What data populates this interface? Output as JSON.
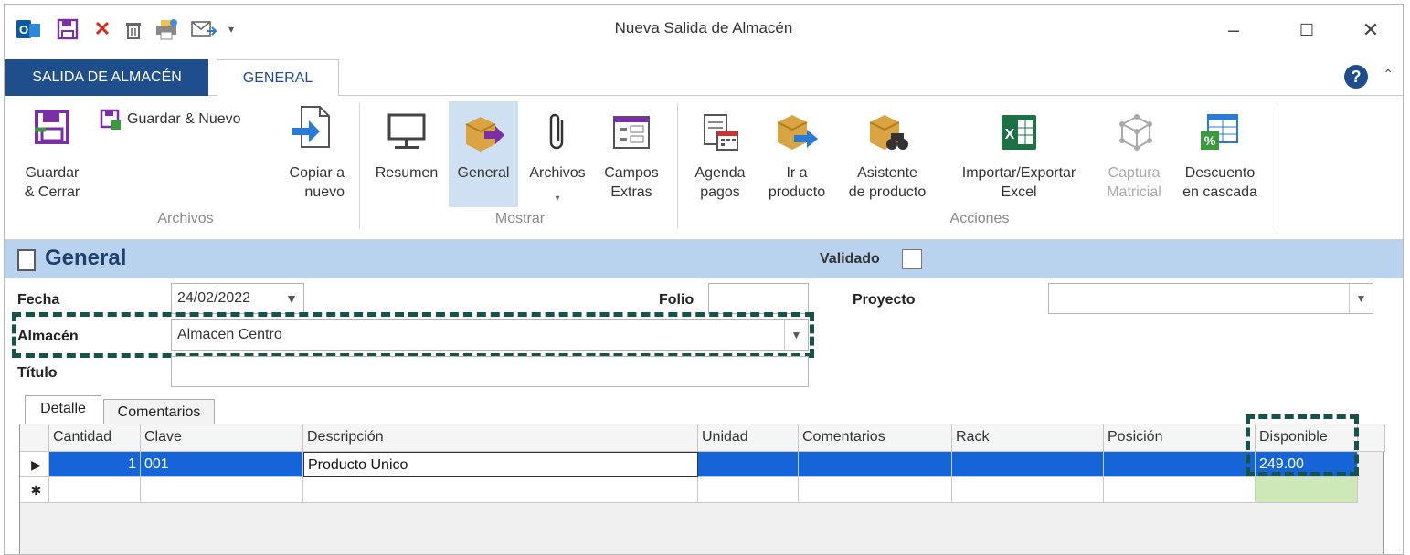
{
  "window": {
    "title": "Nueva Salida de Almacén"
  },
  "tabs": {
    "file_label": "SALIDA DE ALMACÉN",
    "general_label": "GENERAL"
  },
  "ribbon": {
    "guardar_cerrar": "Guardar\n& Cerrar",
    "guardar_nuevo": "Guardar & Nuevo",
    "copiar_nuevo": "Copiar a\nnuevo",
    "group_archivos": "Archivos",
    "resumen": "Resumen",
    "general": "General",
    "archivos": "Archivos",
    "campos_extras": "Campos\nExtras",
    "group_mostrar": "Mostrar",
    "agenda_pagos": "Agenda\npagos",
    "ir_producto": "Ir a\nproducto",
    "asistente_producto": "Asistente\nde producto",
    "importar_exportar": "Importar/Exportar\nExcel",
    "captura_matricial": "Captura\nMatricial",
    "descuento_cascada": "Descuento\nen cascada",
    "group_acciones": "Acciones"
  },
  "general": {
    "title": "General",
    "validado_label": "Validado",
    "validado_checked": false
  },
  "form": {
    "fecha_label": "Fecha",
    "fecha_value": "24/02/2022",
    "folio_label": "Folio",
    "folio_value": "",
    "proyecto_label": "Proyecto",
    "proyecto_value": "",
    "almacen_label": "Almacén",
    "almacen_value": "Almacen Centro",
    "titulo_label": "Título",
    "titulo_value": ""
  },
  "grid_tabs": [
    "Detalle",
    "Comentarios"
  ],
  "grid": {
    "columns": [
      "Cantidad",
      "Clave",
      "Descripción",
      "Unidad",
      "Comentarios",
      "Rack",
      "Posición",
      "Disponible"
    ],
    "rows": [
      {
        "indicator": "▶",
        "cantidad": "1",
        "clave": "001",
        "descripcion": "Producto Unico",
        "unidad": "",
        "comentarios": "",
        "rack": "",
        "posicion": "",
        "disponible": "249.00"
      }
    ],
    "new_row_indicator": "✱"
  },
  "colors": {
    "accent": "#1f4e8c",
    "selection": "#1565d8",
    "highlight_border": "#16534a",
    "header_bar": "#b9d3ee"
  }
}
